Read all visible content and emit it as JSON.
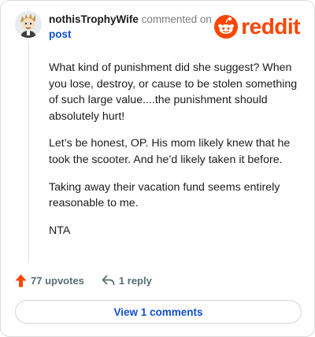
{
  "comment": {
    "username": "nothisTrophyWife",
    "commented_on_text": " commented on ",
    "post_link_text": "post",
    "paragraphs": [
      "What kind of punishment did she suggest? When you lose, destroy, or cause to be stolen something of such large value....the punishment should absolutely hurt!",
      "Let’s be honest, OP. His mom likely knew that he took the scooter. And he’d likely taken it before.",
      "Taking away their vacation fund seems entirely reasonable to me.",
      "NTA"
    ]
  },
  "brand": {
    "wordmark": "reddit",
    "color": "#ff4500"
  },
  "actions": {
    "upvotes_label": "77 upvotes",
    "reply_label": "1 reply",
    "upvote_icon": "upvote-arrow-icon",
    "reply_icon": "reply-arrow-icon"
  },
  "view_comments_label": "View 1 comments",
  "colors": {
    "accent_blue": "#0f4fcf",
    "muted": "#576f76",
    "upvote_orange": "#ff4500"
  }
}
